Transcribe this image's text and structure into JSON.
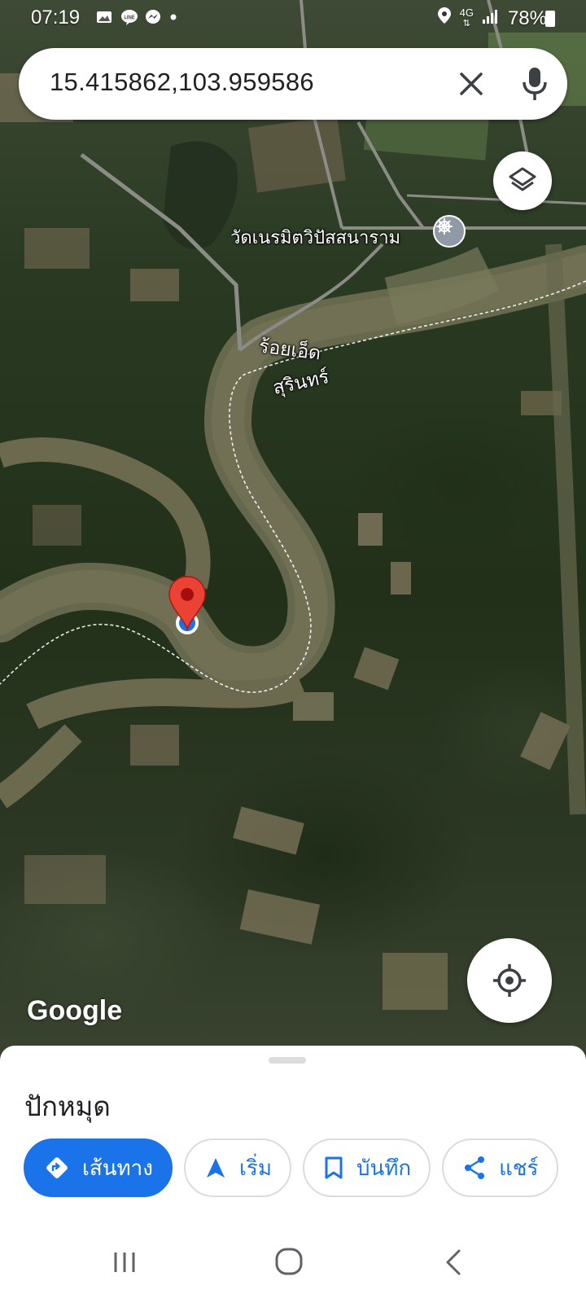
{
  "status_bar": {
    "time": "07:19",
    "network": "4G",
    "battery": "78%",
    "left_icons": [
      "gallery-icon",
      "line-icon",
      "messenger-icon",
      "dot-icon"
    ],
    "right_icons": [
      "location-icon",
      "4g-icon",
      "signal-icon",
      "battery-icon"
    ]
  },
  "search": {
    "query": "15.415862,103.959586",
    "clear_icon": "close-icon",
    "mic_icon": "mic-icon"
  },
  "map": {
    "place_label": "วัดเนรมิตวิปัสสนาราม",
    "place_icon": "temple-icon",
    "province_label_1": "ร้อยเอ็ด",
    "province_label_2": "สุรินทร์",
    "attribution": "Google",
    "pin_color": "#ea4335",
    "location_dot_color": "#1a73e8"
  },
  "bottom_sheet": {
    "title": "ปักหมุด",
    "actions": [
      {
        "label": "เส้นทาง",
        "icon": "directions-icon"
      },
      {
        "label": "เริ่ม",
        "icon": "navigation-arrow-icon"
      },
      {
        "label": "บันทึก",
        "icon": "bookmark-icon"
      },
      {
        "label": "แชร์",
        "icon": "share-icon"
      }
    ]
  },
  "colors": {
    "accent": "#1a73e8",
    "chip_border": "#dadce0",
    "text_primary": "#202124"
  }
}
